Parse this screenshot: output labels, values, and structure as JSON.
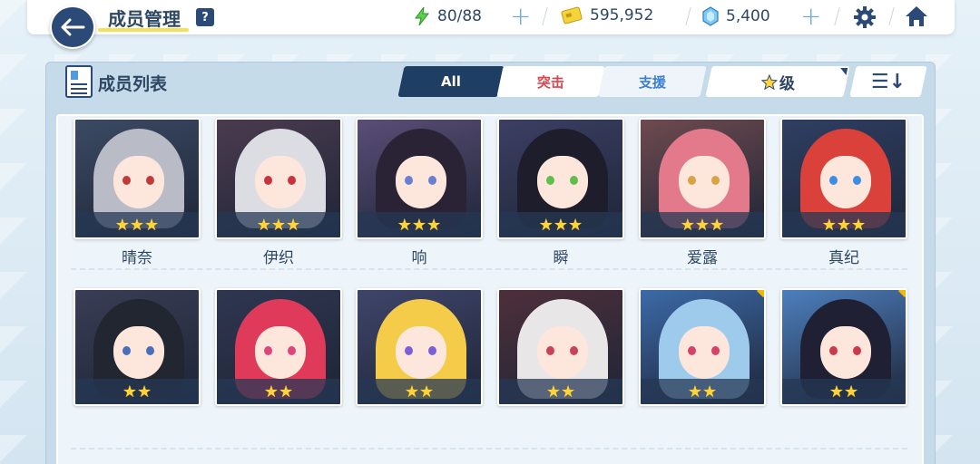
{
  "header": {
    "title": "成员管理",
    "help": "?",
    "ap": "80/88",
    "credits": "595,952",
    "pyroxene": "5,400"
  },
  "panel": {
    "title": "成员列表",
    "tabs": [
      "All",
      "突击",
      "支援"
    ],
    "sort_label": "级",
    "sort_order_icon": "☰↓"
  },
  "students": [
    {
      "name": "晴奈",
      "stars": "★★★",
      "hair": "#b9bcc6",
      "bg": "#3b4a63",
      "eye": "#c23b3b"
    },
    {
      "name": "伊织",
      "stars": "★★★",
      "hair": "#dcdde3",
      "bg": "#4b3b4f",
      "eye": "#c9333c"
    },
    {
      "name": "响",
      "stars": "★★★",
      "hair": "#2a2235",
      "bg": "#5a4e76",
      "eye": "#6a7fd0"
    },
    {
      "name": "瞬",
      "stars": "★★★",
      "hair": "#1d1d2b",
      "bg": "#3c3f63",
      "eye": "#5fbf4b"
    },
    {
      "name": "爱露",
      "stars": "★★★",
      "hair": "#e27a8b",
      "bg": "#6e4a4f",
      "eye": "#d8a443"
    },
    {
      "name": "真纪",
      "stars": "★★★",
      "hair": "#d9413a",
      "bg": "#2f3f62",
      "eye": "#3c8de3"
    },
    {
      "name": "",
      "stars": "★★",
      "hair": "#222630",
      "bg": "#3a3d55",
      "eye": "#4a6fb8",
      "bond": false
    },
    {
      "name": "",
      "stars": "★★",
      "hair": "#e03a5b",
      "bg": "#2f3650",
      "eye": "#e0447e",
      "bond": false
    },
    {
      "name": "",
      "stars": "★★",
      "hair": "#f4cc4a",
      "bg": "#3f456a",
      "eye": "#7b5fd8",
      "bond": false
    },
    {
      "name": "",
      "stars": "★★",
      "hair": "#e9e6e8",
      "bg": "#4e2f3a",
      "eye": "#c6435a",
      "bond": false
    },
    {
      "name": "",
      "stars": "★★",
      "hair": "#9ecbec",
      "bg": "#3c6aa8",
      "eye": "#d6416a",
      "bond": true
    },
    {
      "name": "",
      "stars": "★★",
      "hair": "#1f2034",
      "bg": "#4d7fbe",
      "eye": "#c93a4a",
      "bond": true
    }
  ]
}
